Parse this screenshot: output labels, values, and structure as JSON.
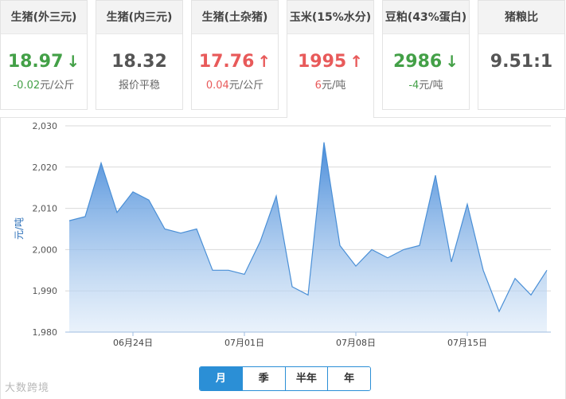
{
  "tabs": [
    {
      "title": "生猪(外三元)",
      "value": "18.97",
      "dir": "down",
      "change": "-0.02",
      "unit": "元/公斤"
    },
    {
      "title": "生猪(内三元)",
      "value": "18.32",
      "dir": "none",
      "change": "",
      "unit": "报价平稳"
    },
    {
      "title": "生猪(土杂猪)",
      "value": "17.76",
      "dir": "up",
      "change": "0.04",
      "unit": "元/公斤"
    },
    {
      "title": "玉米(15%水分)",
      "value": "1995",
      "dir": "up",
      "change": "6",
      "unit": "元/吨"
    },
    {
      "title": "豆粕(43%蛋白)",
      "value": "2986",
      "dir": "down",
      "change": "-4",
      "unit": "元/吨"
    },
    {
      "title": "猪粮比",
      "value": "9.51:1",
      "dir": "none",
      "change": "",
      "unit": ""
    }
  ],
  "active_tab": 3,
  "icons": {
    "up": "up-arrow-icon",
    "down": "down-arrow-icon"
  },
  "colors": {
    "up": "#e85a5a",
    "down": "#43a047",
    "accent": "#2b8fd6",
    "line": "#4a8fd6"
  },
  "range_tabs": [
    {
      "label": "月",
      "active": true
    },
    {
      "label": "季",
      "active": false
    },
    {
      "label": "半年",
      "active": false
    },
    {
      "label": "年",
      "active": false
    }
  ],
  "watermark": "大数跨境",
  "chart_data": {
    "type": "area",
    "ylabel": "元/吨",
    "ylim": [
      1980,
      2030
    ],
    "yticks": [
      "1,980",
      "1,990",
      "2,000",
      "2,010",
      "2,020",
      "2,030"
    ],
    "xticks": [
      "06月24日",
      "07月01日",
      "07月08日",
      "07月15日"
    ],
    "values": [
      2007,
      2008,
      2021,
      2009,
      2014,
      2012,
      2005,
      2004,
      2005,
      1995,
      1995,
      1994,
      2002,
      2013,
      1991,
      1989,
      2026,
      2001,
      1996,
      2000,
      1998,
      2000,
      2001,
      2018,
      1997,
      2011,
      1995,
      1985,
      1993,
      1989,
      1995
    ],
    "grid": true
  }
}
